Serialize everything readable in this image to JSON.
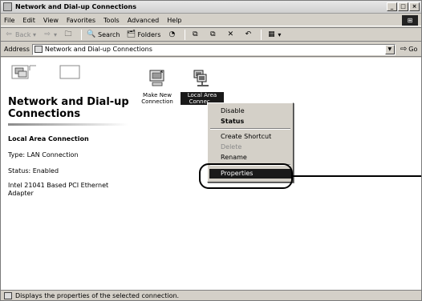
{
  "window": {
    "title": "Network and Dial-up Connections"
  },
  "menubar": {
    "items": [
      "File",
      "Edit",
      "View",
      "Favorites",
      "Tools",
      "Advanced",
      "Help"
    ]
  },
  "toolbar": {
    "back_label": "Back",
    "search_label": "Search",
    "folders_label": "Folders"
  },
  "address": {
    "label": "Address",
    "value": "Network and Dial-up Connections",
    "go_label": "Go"
  },
  "leftpane": {
    "folder_title": "Network and Dial-up Connections",
    "selected_name": "Local Area Connection",
    "type_line": "Type: LAN Connection",
    "status_line": "Status: Enabled",
    "adapter_line": "Intel 21041 Based PCI Ethernet Adapter"
  },
  "icons": {
    "make_new": "Make New Connection",
    "local_area": "Local Area Connec..."
  },
  "context_menu": {
    "disable": "Disable",
    "status": "Status",
    "create_shortcut": "Create Shortcut",
    "delete": "Delete",
    "rename": "Rename",
    "properties": "Properties"
  },
  "statusbar": {
    "text": "Displays the properties of the selected connection."
  }
}
